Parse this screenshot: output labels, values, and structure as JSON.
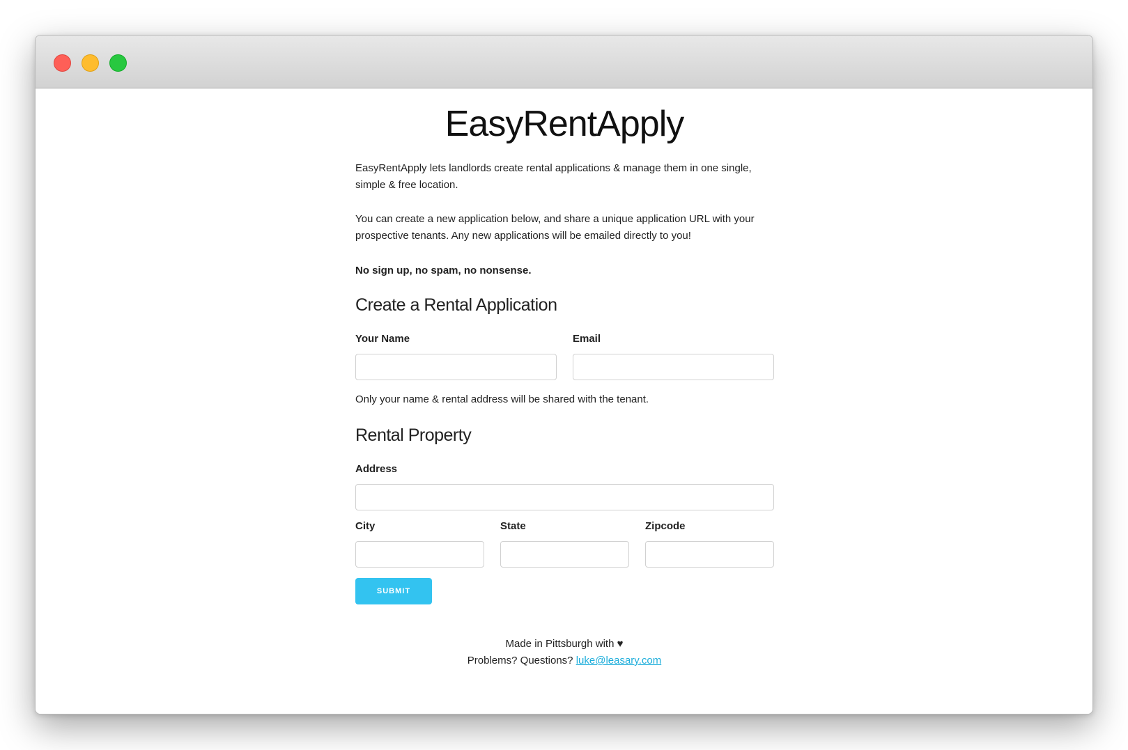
{
  "window": {
    "controls": [
      "close",
      "minimize",
      "maximize"
    ],
    "colors": {
      "close": "#fe5f57",
      "minimize": "#febc2e",
      "maximize": "#28c840"
    }
  },
  "page": {
    "title": "EasyRentApply",
    "intro": "EasyRentApply lets landlords create rental applications & manage them in one single, simple & free location.",
    "description": "You can create a new application below, and share a unique application URL with your prospective tenants. Any new applications will be emailed directly to you!",
    "tagline": "No sign up, no spam, no nonsense."
  },
  "form": {
    "section_landlord": "Create a Rental Application",
    "name_label": "Your Name",
    "name_value": "",
    "email_label": "Email",
    "email_value": "",
    "privacy_note": "Only your name & rental address will be shared with the tenant.",
    "section_property": "Rental Property",
    "address_label": "Address",
    "address_value": "",
    "city_label": "City",
    "city_value": "",
    "state_label": "State",
    "state_value": "",
    "zip_label": "Zipcode",
    "zip_value": "",
    "submit_label": "SUBMIT",
    "accent_color": "#33c3f0"
  },
  "footer": {
    "made_in": "Made in Pittsburgh with ♥",
    "contact_prefix": "Problems? Questions?",
    "contact_email": "luke@leasary.com",
    "link_color": "#1eaedb"
  }
}
